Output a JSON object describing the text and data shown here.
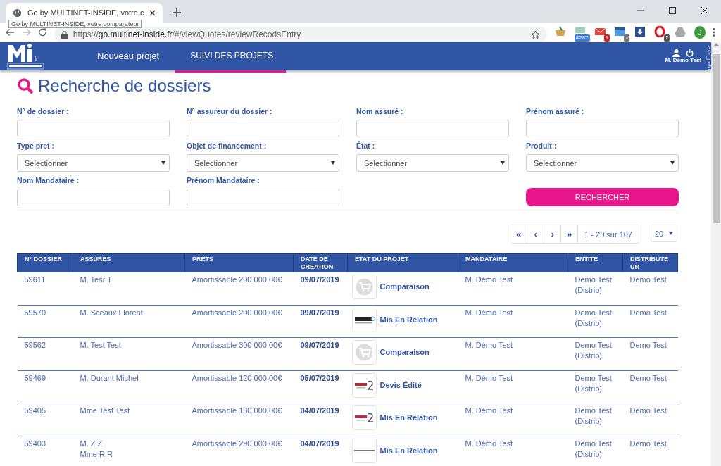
{
  "browser": {
    "tab_title": "Go by MULTINET-INSIDE, votre c",
    "tooltip": "Go by MULTINET-INSIDE, votre comparateur",
    "url_scheme": "https://",
    "url_host": "go.multinet-inside.fr",
    "url_path": "/#/viewQuotes/reviewRecodsEntry",
    "extensions": [
      {
        "kind": "basket"
      },
      {
        "kind": "stats",
        "badge": "4287"
      },
      {
        "kind": "mail",
        "badge": "9"
      },
      {
        "kind": "window",
        "badge": "x"
      },
      {
        "kind": "download"
      },
      {
        "kind": "opera",
        "badge": "2"
      },
      {
        "kind": "drive"
      }
    ],
    "avatar": "J"
  },
  "header": {
    "nav": [
      {
        "label": "Nouveau projet",
        "selected": false
      },
      {
        "label": "SUIVI DES PROJETS",
        "selected": true
      }
    ],
    "user": "M. Démo Test",
    "env": "axlr_prdd"
  },
  "title": "Recherche de dossiers",
  "filters": [
    {
      "label": "N° de dossier :",
      "kind": "input"
    },
    {
      "label": "N° assureur du dossier :",
      "kind": "input"
    },
    {
      "label": "Nom assuré :",
      "kind": "input"
    },
    {
      "label": "Prénom assuré :",
      "kind": "input"
    },
    {
      "label": "Type pret :",
      "kind": "select",
      "value": "Selectionner"
    },
    {
      "label": "Objet de financement :",
      "kind": "select",
      "value": "Selectionner"
    },
    {
      "label": "État :",
      "kind": "select",
      "value": "Selectionner"
    },
    {
      "label": "Produit :",
      "kind": "select",
      "value": "Selectionner"
    },
    {
      "label": "Nom Mandataire :",
      "kind": "input"
    },
    {
      "label": "Prénom Mandataire :",
      "kind": "input"
    }
  ],
  "search_button": "RECHERCHER",
  "pagination": {
    "buttons": [
      "«",
      "‹",
      "›",
      "»"
    ],
    "range": "1 - 20 sur 107",
    "page_size": "20"
  },
  "table": {
    "columns": [
      "N° DOSSIER",
      "ASSURÉS",
      "PRÊTS",
      "DATE DE CREATION",
      "ETAT DU PROJET",
      "MANDATAIRE",
      "ENTITÉ",
      "DISTRIBUTEUR"
    ],
    "rows": [
      {
        "dossier": "59611",
        "assures": [
          "M. Tesr T"
        ],
        "pret": "Amortissable 200 000,00€",
        "date": "09/07/2019",
        "etat": {
          "kind": "cart",
          "label": "Comparaison"
        },
        "mandataire": "M. Démo Test",
        "entite": "Demo Test (Distrib)",
        "distributeur": "Demo Test"
      },
      {
        "dossier": "59570",
        "assures": [
          "M. Sceaux Florent"
        ],
        "pret": "Amortissable 200 000,00€",
        "date": "09/07/2019",
        "etat": {
          "kind": "allazo",
          "label": "Mis En Relation"
        },
        "mandataire": "M. Démo Test",
        "entite": "Demo Test (Distrib)",
        "distributeur": "Demo Test"
      },
      {
        "dossier": "59562",
        "assures": [
          "M. Test Test"
        ],
        "pret": "Amortissable 300 000,00€",
        "date": "09/07/2019",
        "etat": {
          "kind": "cart",
          "label": "Comparaison"
        },
        "mandataire": "M. Démo Test",
        "entite": "Demo Test (Distrib)",
        "distributeur": "Demo Test"
      },
      {
        "dossier": "59469",
        "assures": [
          "M. Durant Michel"
        ],
        "pret": "Amortissable 120 000,00€",
        "date": "05/07/2019",
        "etat": {
          "kind": "r2",
          "label": "Devis Édité"
        },
        "mandataire": "M. Démo Test",
        "entite": "Demo Test (Distrib)",
        "distributeur": "Demo Test"
      },
      {
        "dossier": "59405",
        "assures": [
          "Mme Test Test"
        ],
        "pret": "Amortissable 180 000,00€",
        "date": "04/07/2019",
        "etat": {
          "kind": "r2",
          "label": "Mis En Relation"
        },
        "mandataire": "M. Démo Test",
        "entite": "Demo Test (Distrib)",
        "distributeur": "Demo Test"
      },
      {
        "dossier": "59403",
        "assures": [
          "M. Z Z",
          "Mme R R"
        ],
        "pret": "Amortissable 290 000,00€",
        "date": "04/07/2019",
        "etat": {
          "kind": "bar",
          "label": "Mis En Relation"
        },
        "mandataire": "M. Démo Test",
        "entite": "Demo Test (Distrib)",
        "distributeur": "Demo Test"
      }
    ]
  }
}
